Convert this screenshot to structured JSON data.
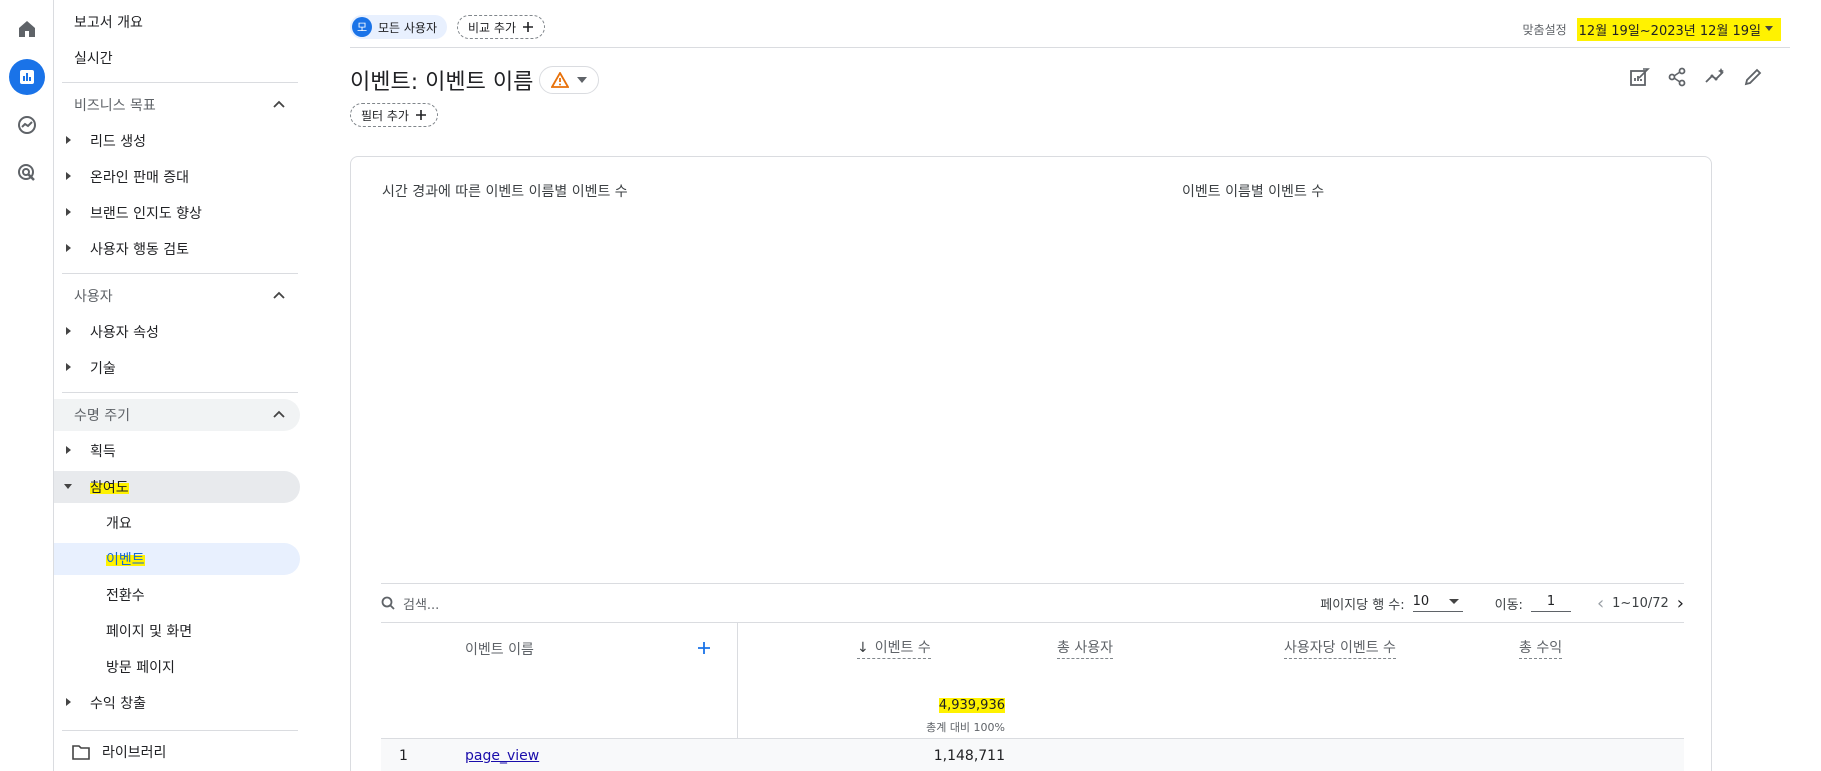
{
  "rail": {
    "icons": [
      "home-icon",
      "reports-icon",
      "explore-icon",
      "advertising-icon"
    ]
  },
  "sidebar": {
    "top_items": [
      "보고서 개요",
      "실시간"
    ],
    "section_business": "비즈니스 목표",
    "business_items": [
      "리드 생성",
      "온라인 판매 증대",
      "브랜드 인지도 향상",
      "사용자 행동 검토"
    ],
    "section_user": "사용자",
    "user_items": [
      "사용자 속성",
      "기술"
    ],
    "section_lifecycle": "수명 주기",
    "lifecycle_items": [
      "획득",
      "참여도"
    ],
    "engagement_sub": [
      "개요",
      "이벤트",
      "전환수",
      "페이지 및 화면",
      "방문 페이지"
    ],
    "monetization": "수익 창출",
    "library": "라이브러리"
  },
  "topbar": {
    "user_chip_avatar": "모",
    "user_chip_label": "모든 사용자",
    "compare_label": "비교 추가",
    "date_label": "맞춤설정",
    "date_value": "12월 19일~2023년 12월 19일"
  },
  "header": {
    "title": "이벤트: 이벤트 이름",
    "filter_label": "필터 추가"
  },
  "charts": {
    "left_title": "시간 경과에 따른 이벤트 이름별 이벤트 수",
    "right_title": "이벤트 이름별 이벤트 수"
  },
  "table": {
    "search_placeholder": "검색...",
    "rows_per_page_label": "페이지당 행 수:",
    "rows_per_page_value": "10",
    "goto_label": "이동:",
    "goto_value": "1",
    "range": "1~10/72",
    "col_name": "이벤트 이름",
    "col_events": "이벤트 수",
    "col_users": "총 사용자",
    "col_per_user": "사용자당 이벤트 수",
    "col_revenue": "총 수익",
    "total_events": "4,939,936",
    "total_pct": "총계 대비 100%",
    "rows": [
      {
        "index": "1",
        "name": "page_view",
        "events": "1,148,711"
      }
    ]
  },
  "colors": {
    "accent": "#1a73e8",
    "highlight": "#fff200",
    "active_bg": "#e8f0fe"
  }
}
